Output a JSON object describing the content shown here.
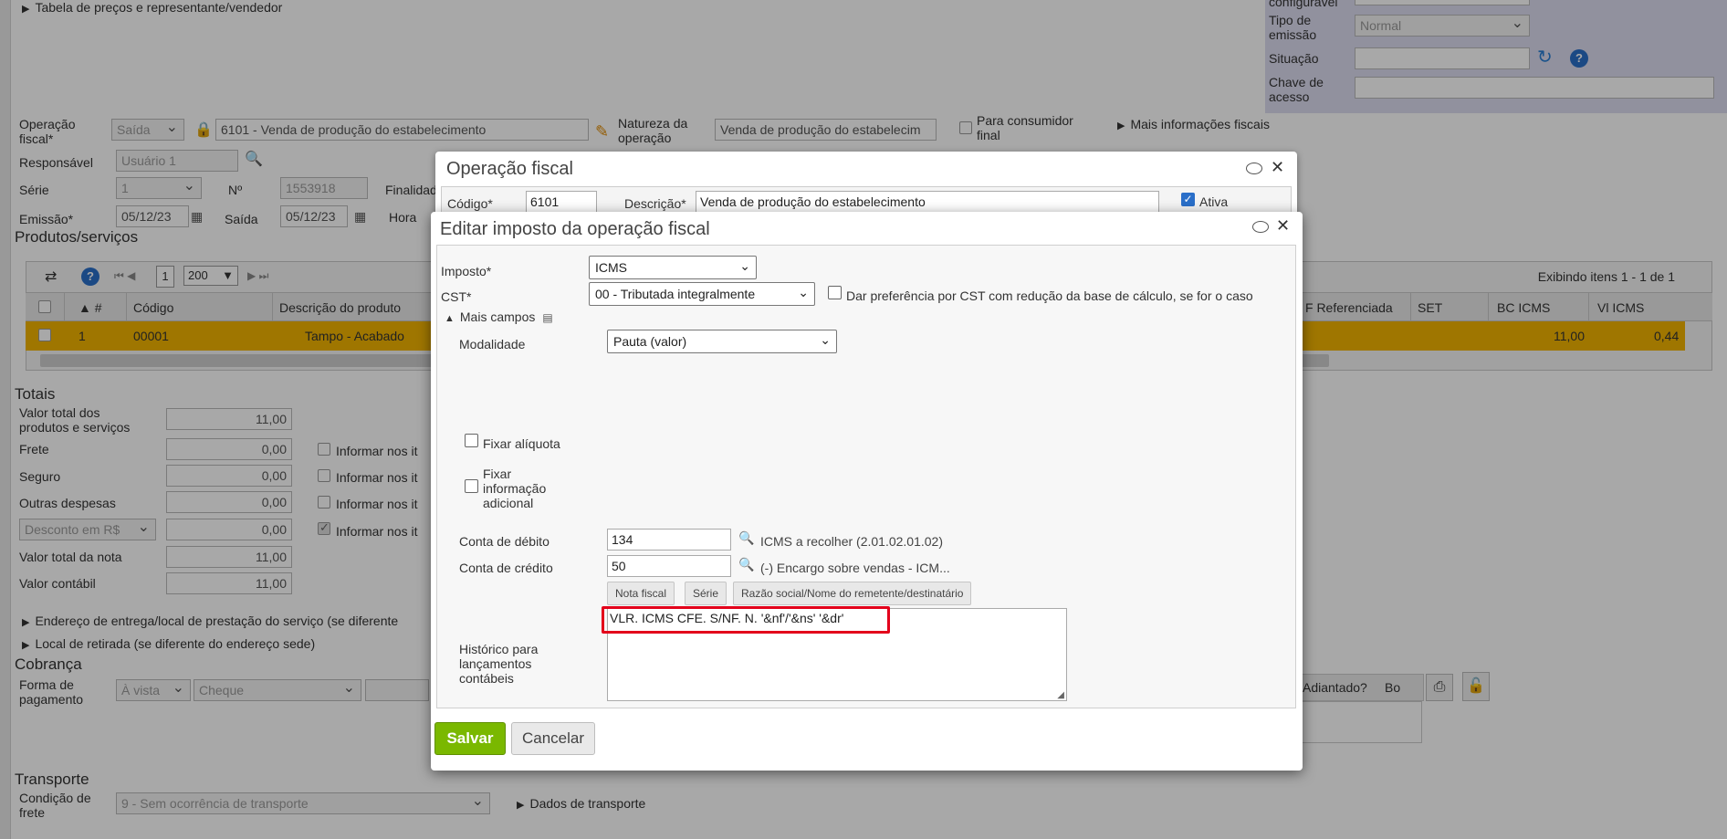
{
  "bg": {
    "tabela_label": "Tabela de preços e representante/vendedor",
    "right_panel": {
      "configuravel": "configurável",
      "tipo_emissao_label": "Tipo de emissão",
      "tipo_emissao_value": "Normal",
      "situacao_label": "Situação",
      "chave_label": "Chave de acesso"
    },
    "operacao_label": "Operação fiscal*",
    "operacao_tipo": "Saída",
    "operacao_value": "6101 - Venda de produção do estabelecimento",
    "natureza_label": "Natureza da operação",
    "natureza_value": "Venda de produção do estabelecim",
    "consumidor_label": "Para consumidor final",
    "mais_info_label": "Mais informações fiscais",
    "responsavel_label": "Responsável",
    "responsavel_value": "Usuário 1",
    "serie_label": "Série",
    "serie_value": "1",
    "numero_label": "Nº",
    "numero_value": "1553918",
    "finalidade_label": "Finalidad",
    "emissao_label": "Emissão*",
    "emissao_value": "05/12/23",
    "saida_label": "Saída",
    "saida_value": "05/12/23",
    "hora_label": "Hora",
    "produtos_title": "Produtos/serviços",
    "pager_page": "1",
    "pager_size": "200",
    "exibindo": "Exibindo itens 1 - 1 de 1",
    "grid_headers": [
      "#",
      "Código",
      "Descrição do produto",
      "F Referenciada",
      "SET",
      "BC ICMS",
      "Vl ICMS"
    ],
    "grid_row": {
      "num": "1",
      "codigo": "00001",
      "descricao": "Tampo - Acabado",
      "bc_icms": "11,00",
      "vl_icms": "0,44"
    },
    "totais_title": "Totais",
    "totais": [
      {
        "label": "Valor total dos produtos e serviços",
        "value": "11,00"
      },
      {
        "label": "Frete",
        "value": "0,00"
      },
      {
        "label": "Seguro",
        "value": "0,00"
      },
      {
        "label": "Outras despesas",
        "value": "0,00"
      },
      {
        "label": "Desconto em R$",
        "value": "0,00"
      },
      {
        "label": "Valor total da nota",
        "value": "11,00"
      },
      {
        "label": "Valor contábil",
        "value": "11,00"
      }
    ],
    "informar": "Informar nos it",
    "endereco_entrega": "Endereço de entrega/local de prestação do serviço (se diferente",
    "local_retirada": "Local de retirada (se diferente do endereço sede)",
    "cobranca_title": "Cobrança",
    "forma_pagamento_label": "Forma de pagamento",
    "forma_pagamento_value": "À vista",
    "cheque_value": "Cheque",
    "adiantado": "Adiantado?",
    "bo": "Bo",
    "transporte_title": "Transporte",
    "condicao_frete_label": "Condição de frete",
    "condicao_frete_value": "9 - Sem ocorrência de transporte",
    "dados_transporte": "Dados de transporte"
  },
  "back_dialog": {
    "title": "Operação fiscal",
    "codigo_label": "Código*",
    "codigo_value": "6101",
    "descricao_label": "Descrição*",
    "descricao_value": "Venda de produção do estabelecimento",
    "ativa_label": "Ativa"
  },
  "dialog": {
    "title": "Editar imposto da operação fiscal",
    "imposto_label": "Imposto*",
    "imposto_value": "ICMS",
    "cst_label": "CST*",
    "cst_value": "00 - Tributada integralmente",
    "preferencia_label": "Dar preferência por CST com redução da base de cálculo, se for o caso",
    "mais_campos": "Mais campos",
    "modalidade_label": "Modalidade",
    "modalidade_value": "Pauta (valor)",
    "fixar_aliquota": "Fixar alíquota",
    "fixar_info": "Fixar informação adicional",
    "conta_debito_label": "Conta de débito",
    "conta_debito_value": "134",
    "conta_debito_desc": "ICMS a recolher (2.01.02.01.02)",
    "conta_credito_label": "Conta de crédito",
    "conta_credito_value": "50",
    "conta_credito_desc": "(-) Encargo sobre vendas - ICM...",
    "btn_nota": "Nota fiscal",
    "btn_serie": "Série",
    "btn_razao": "Razão social/Nome do remetente/destinatário",
    "historico_label": "Histórico para lançamentos contábeis",
    "historico_value": "VLR. ICMS CFE. S/NF. N. '&nf'/'&ns' '&dr'",
    "save": "Salvar",
    "cancel": "Cancelar"
  }
}
